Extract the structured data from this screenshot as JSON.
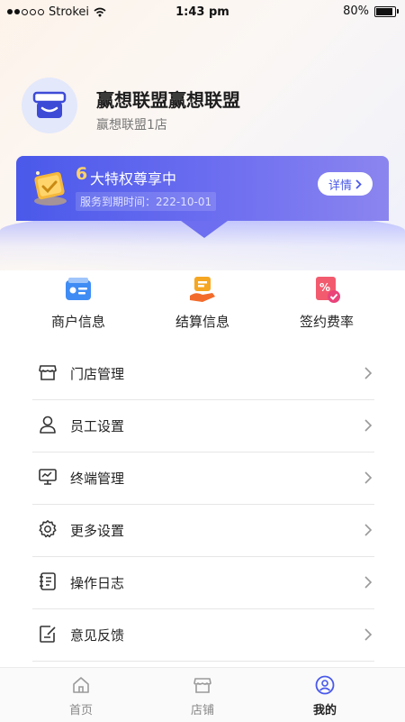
{
  "status_bar": {
    "carrier": "Strokei",
    "time": "1:43 pm",
    "battery": "80%"
  },
  "profile": {
    "name": "赢想联盟赢想联盟",
    "branch": "赢想联盟1店"
  },
  "vip": {
    "count": "6",
    "title": "大特权尊享中",
    "expire_label": "服务到期时间：",
    "expire_date": "222-10-01",
    "detail_label": "详情"
  },
  "quick_actions": [
    {
      "label": "商户信息",
      "icon": "merchant-card-icon"
    },
    {
      "label": "结算信息",
      "icon": "settlement-icon"
    },
    {
      "label": "签约费率",
      "icon": "rate-icon"
    }
  ],
  "menu": [
    {
      "label": "门店管理",
      "icon": "store-icon"
    },
    {
      "label": "员工设置",
      "icon": "user-icon"
    },
    {
      "label": "终端管理",
      "icon": "monitor-icon"
    },
    {
      "label": "更多设置",
      "icon": "gear-icon"
    },
    {
      "label": "操作日志",
      "icon": "log-icon"
    },
    {
      "label": "意见反馈",
      "icon": "feedback-icon"
    }
  ],
  "tabs": [
    {
      "label": "首页",
      "icon": "home-icon",
      "active": false
    },
    {
      "label": "店铺",
      "icon": "shop-icon",
      "active": false
    },
    {
      "label": "我的",
      "icon": "profile-icon",
      "active": true
    }
  ],
  "colors": {
    "accent": "#4a59ea",
    "gold": "#ffd26b",
    "active_tab": "#4a59ea"
  }
}
